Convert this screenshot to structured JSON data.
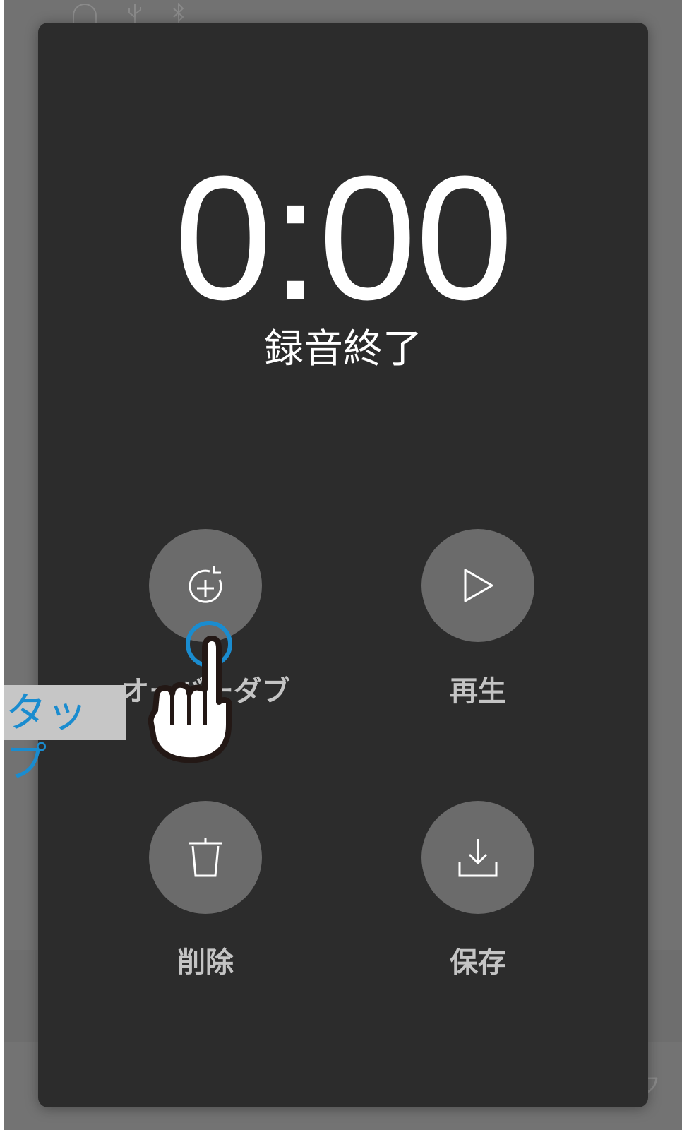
{
  "timer": {
    "display": "0:00"
  },
  "status": {
    "text": "録音終了"
  },
  "actions": {
    "overdub": {
      "label": "オーバーダブ",
      "icon": "overdub-plus-icon"
    },
    "play": {
      "label": "再生",
      "icon": "play-icon"
    },
    "delete": {
      "label": "削除",
      "icon": "trash-icon"
    },
    "save": {
      "label": "保存",
      "icon": "download-icon"
    }
  },
  "annotation": {
    "label": "タップ",
    "accent_color": "#1a8ccf"
  },
  "background": {
    "status_icons": [
      "headphone-icon",
      "usb-icon",
      "bluetooth-icon"
    ],
    "corner_char": "フ"
  },
  "colors": {
    "panel": "#2c2c2c",
    "button": "#6b6b6b",
    "label": "#c4c4c4",
    "text": "#ffffff"
  }
}
